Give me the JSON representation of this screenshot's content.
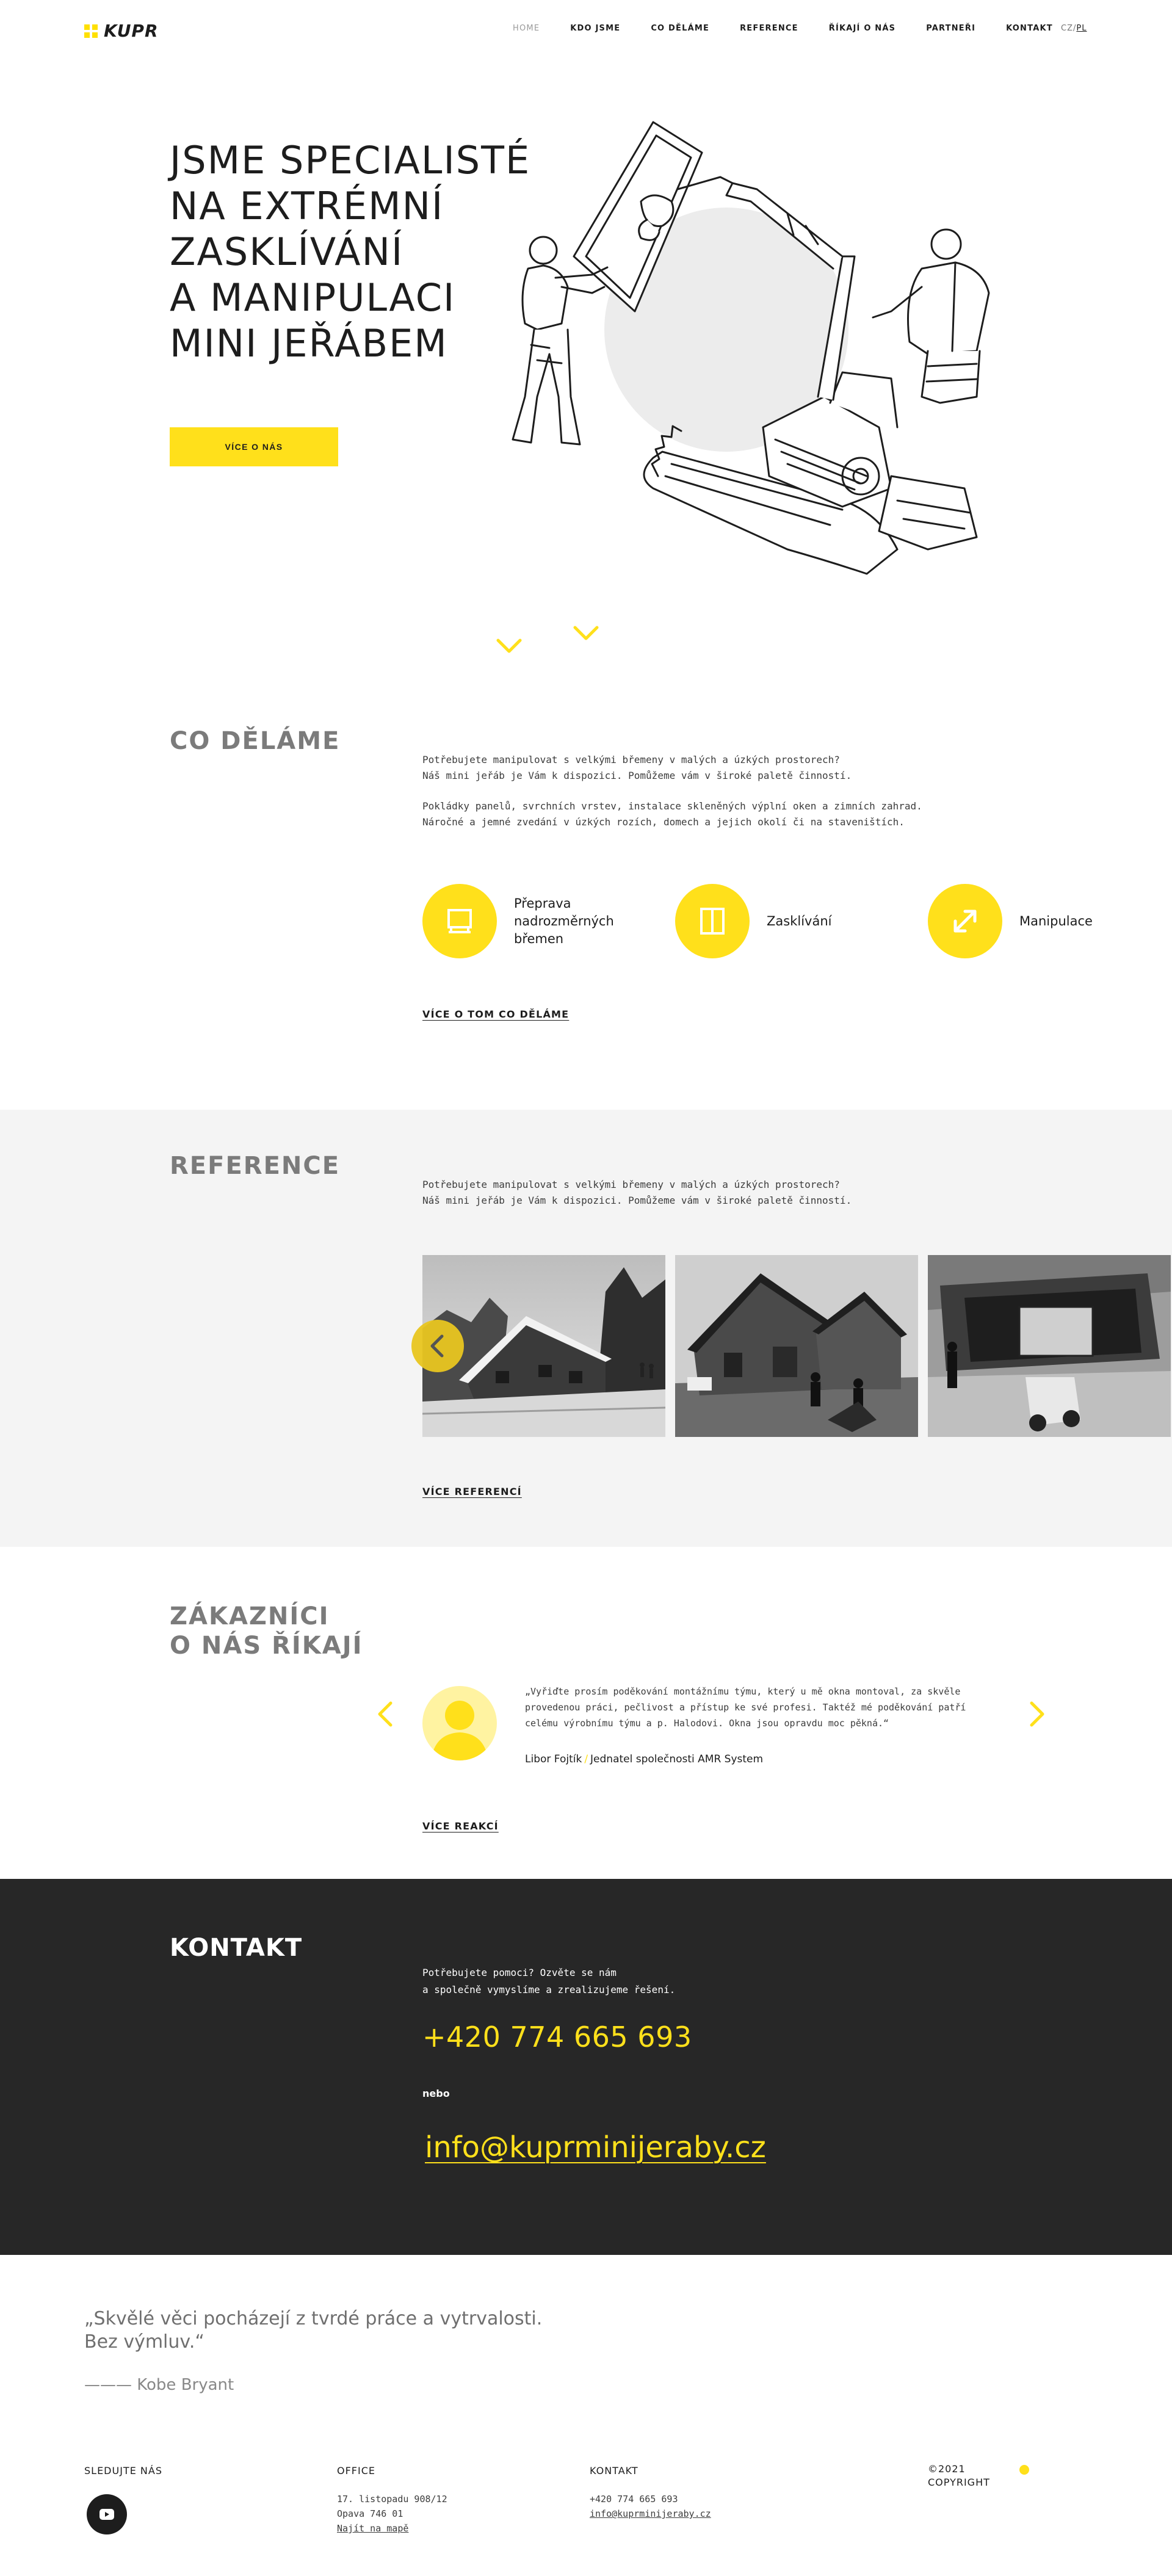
{
  "brand": {
    "logo_text": "KUPR",
    "accent": "#ffe01b",
    "dark": "#272727"
  },
  "nav": {
    "items": [
      "HOME",
      "KDO JSME",
      "CO DĚLÁME",
      "REFERENCE",
      "ŘÍKAJÍ O NÁS",
      "PARTNEŘI",
      "KONTAKT"
    ],
    "active": "HOME",
    "lang_cz": "CZ",
    "lang_sep": "/",
    "lang_pl": "PL"
  },
  "hero": {
    "title_lines": [
      "JSME SPECIALISTÉ",
      "NA EXTRÉMNÍ",
      "ZASKLÍVÁNÍ",
      "A MANIPULACI",
      "MINI JEŘÁBEM"
    ],
    "button": "VÍCE O NÁS",
    "illustration_icon": "crane-glazing-illustration"
  },
  "services": {
    "heading": "CO DĚLÁME",
    "para1_lines": [
      "Potřebujete manipulovat s velkými břemeny v malých a úzkých prostorech?",
      "Náš mini jeřáb je Vám k dispozici. Pomůžeme vám v široké paletě činností."
    ],
    "para2_lines": [
      "Pokládky panelů, svrchních vrstev, instalace skleněných výplní oken a zimních zahrad.",
      "Náročné a jemné zvedání v úzkých rozích, domech a jejich okolí či na staveništích."
    ],
    "items": [
      {
        "label_lines": [
          "Přeprava",
          "nadrozměrných",
          "břemen"
        ],
        "icon": "transport-icon"
      },
      {
        "label_lines": [
          "Zasklívání"
        ],
        "icon": "window-icon"
      },
      {
        "label_lines": [
          "Manipulace"
        ],
        "icon": "expand-arrows-icon"
      }
    ],
    "more": "VÍCE O TOM CO DĚLÁME"
  },
  "reference": {
    "heading": "REFERENCE",
    "para_lines": [
      "Potřebujete manipulovat s velkými břemeny v malých a úzkých prostorech?",
      "Náš mini jeřáb je Vám k dispozici. Pomůžeme vám v široké paletě činností."
    ],
    "photos": [
      "mountain-chalet-photo",
      "house-roofing-photo",
      "container-house-photo"
    ],
    "more": "VÍCE REFERENCÍ"
  },
  "testimonials": {
    "heading_lines": [
      "ZÁKAZNÍCI",
      "O NÁS ŘÍKAJÍ"
    ],
    "quote": "„Vyřiďte prosím poděkování montážnímu týmu, který u mě okna montoval, za skvěle provedenou práci, pečlivost a přístup ke své profesi. Taktéž mé poděkování patří celému výrobnímu týmu a p. Halodovi. Okna jsou opravdu moc pěkná.“",
    "author": "Libor Fojtík",
    "author_sep": "/",
    "author_role": "Jednatel společnosti AMR System",
    "more": "VÍCE REAKCÍ"
  },
  "contact": {
    "heading": "KONTAKT",
    "text_lines": [
      "Potřebujete pomoci? Ozvěte se nám",
      "a společně vymyslíme a zrealizujeme řešení."
    ],
    "phone": "+420 774 665 693",
    "or": "nebo",
    "email": "info@kuprminijeraby.cz"
  },
  "motto": {
    "lines": [
      "„Skvělé věci pocházejí z tvrdé práce a vytrvalosti.",
      "Bez výmluv.“"
    ],
    "author": "——— Kobe Bryant"
  },
  "footer": {
    "follow": "SLEDUJTE NÁS",
    "office_h": "OFFICE",
    "office_lines": [
      "17. listopadu 908/12",
      "Opava 746 01"
    ],
    "map_link": "Najít na mapě",
    "contact_h": "KONTAKT",
    "contact_phone": "+420 774 665 693",
    "contact_email": "info@kuprminijeraby.cz",
    "year": "©2021",
    "copyright": "COPYRIGHT"
  }
}
